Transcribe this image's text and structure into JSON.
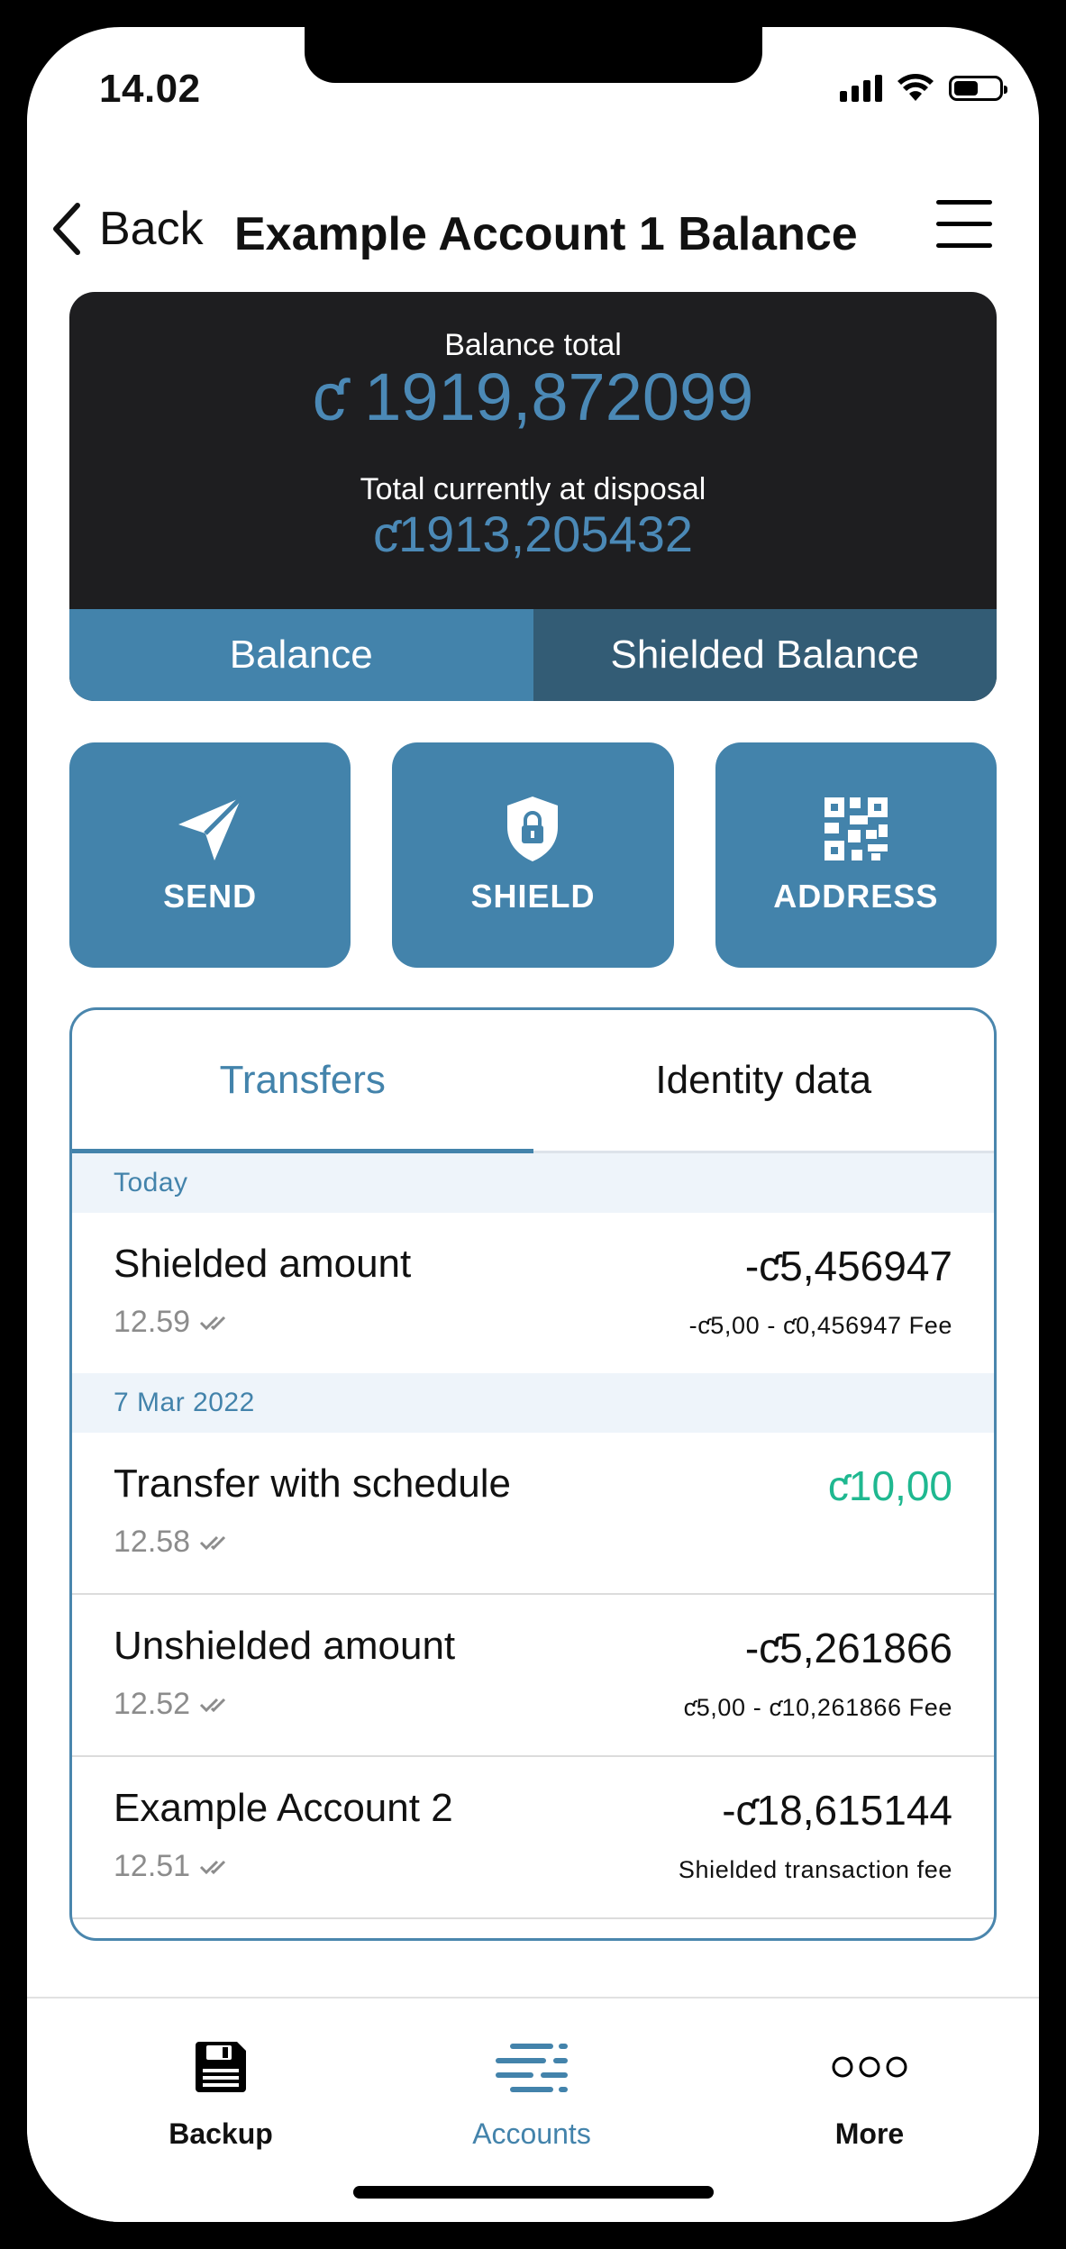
{
  "status_bar": {
    "time": "14.02"
  },
  "nav": {
    "back_label": "Back",
    "title": "Example Account 1 Balance"
  },
  "balance": {
    "total_label": "Balance total",
    "total_value": "ƈ 1919,872099",
    "disposal_label": "Total currently at disposal",
    "disposal_value": "ƈ1913,205432",
    "toggle": [
      "Balance",
      "Shielded Balance"
    ],
    "selected_toggle": "Balance"
  },
  "actions": [
    {
      "label": "SEND",
      "icon": "paper-plane-icon"
    },
    {
      "label": "SHIELD",
      "icon": "shield-lock-icon"
    },
    {
      "label": "ADDRESS",
      "icon": "qr-code-icon"
    }
  ],
  "tabs": {
    "transfers": "Transfers",
    "identity": "Identity data",
    "active": "Transfers"
  },
  "transactions": [
    {
      "date": "Today",
      "items": [
        {
          "name": "Shielded amount",
          "time": "12.59",
          "amount": "-ƈ5,456947",
          "detail": "-ƈ5,00 - ƈ0,456947 Fee"
        }
      ]
    },
    {
      "date": "7 Mar 2022",
      "items": [
        {
          "name": "Transfer with schedule",
          "time": "12.58",
          "amount": "ƈ10,00",
          "detail": ""
        },
        {
          "name": "Unshielded amount",
          "time": "12.52",
          "amount": "-ƈ5,261866",
          "detail": "ƈ5,00 - ƈ10,261866 Fee"
        },
        {
          "name": "Example Account 2",
          "time": "12.51",
          "amount": "-ƈ18,615144",
          "detail": "Shielded transaction fee"
        }
      ]
    }
  ],
  "tabbar": [
    {
      "label": "Backup",
      "icon": "floppy-disk-icon"
    },
    {
      "label": "Accounts",
      "icon": "accounts-list-icon"
    },
    {
      "label": "More",
      "icon": "more-dots-icon"
    }
  ],
  "tabbar_active": "Accounts",
  "colors": {
    "accent": "#4383ab",
    "positive": "#1fb890",
    "card": "#1e1e20",
    "shielded_toggle": "#335c75"
  }
}
